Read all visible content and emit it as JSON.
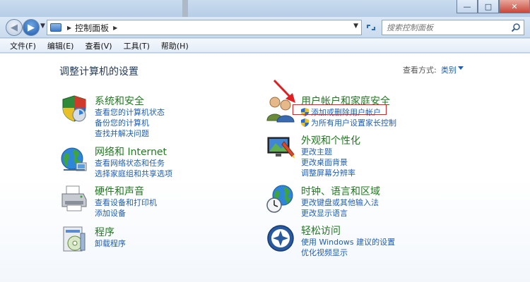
{
  "window": {
    "minimize": "—",
    "maximize": "□",
    "close": "✕"
  },
  "nav": {
    "address_location": "控制面板",
    "search_placeholder": "搜索控制面板"
  },
  "menu": {
    "items": [
      "文件(F)",
      "编辑(E)",
      "查看(V)",
      "工具(T)",
      "帮助(H)"
    ]
  },
  "main": {
    "title": "调整计算机的设置",
    "view_label": "查看方式:",
    "view_value": "类别"
  },
  "categories": [
    {
      "title": "系统和安全",
      "icon": "shield-icon",
      "links": [
        "查看您的计算机状态",
        "备份您的计算机",
        "查找并解决问题"
      ]
    },
    {
      "title": "网络和 Internet",
      "icon": "network-globe-icon",
      "links": [
        "查看网络状态和任务",
        "选择家庭组和共享选项"
      ]
    },
    {
      "title": "硬件和声音",
      "icon": "printer-icon",
      "links": [
        "查看设备和打印机",
        "添加设备"
      ]
    },
    {
      "title": "程序",
      "icon": "programs-icon",
      "links": [
        "卸载程序"
      ]
    },
    {
      "title": "用户帐户和家庭安全",
      "icon": "users-icon",
      "links": [
        "添加或删除用户帐户",
        "为所有用户设置家长控制"
      ]
    },
    {
      "title": "外观和个性化",
      "icon": "monitor-paint-icon",
      "links": [
        "更改主题",
        "更改桌面背景",
        "调整屏幕分辨率"
      ]
    },
    {
      "title": "时钟、语言和区域",
      "icon": "clock-globe-icon",
      "links": [
        "更改键盘或其他输入法",
        "更改显示语言"
      ]
    },
    {
      "title": "轻松访问",
      "icon": "ease-of-access-icon",
      "links": [
        "使用 Windows 建议的设置",
        "优化视频显示"
      ]
    }
  ],
  "colors": {
    "category_title": "#1f7a1f",
    "link": "#1e5eb8",
    "highlight": "#e02020"
  }
}
